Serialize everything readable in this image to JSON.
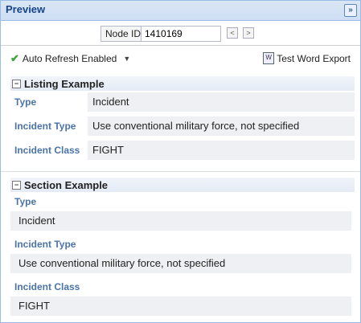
{
  "header": {
    "title": "Preview",
    "collapse_glyph": "»"
  },
  "node": {
    "label": "Node ID",
    "value": "1410169",
    "prev_glyph": "<",
    "next_glyph": ">"
  },
  "toolbar": {
    "check_glyph": "✔",
    "auto_refresh_label": "Auto Refresh Enabled",
    "caret_glyph": "▼",
    "export_label": "Test Word Export",
    "export_icon_glyph": "W"
  },
  "listing": {
    "toggle_glyph": "−",
    "title": "Listing Example",
    "rows": [
      {
        "label": "Type",
        "value": "Incident"
      },
      {
        "label": "Incident Type",
        "value": "Use conventional military force, not specified"
      },
      {
        "label": "Incident Class",
        "value": "FIGHT"
      }
    ]
  },
  "section": {
    "toggle_glyph": "−",
    "title": "Section Example",
    "rows": [
      {
        "label": "Type",
        "value": "Incident"
      },
      {
        "label": "Incident Type",
        "value": "Use conventional military force, not specified"
      },
      {
        "label": "Incident Class",
        "value": "FIGHT"
      }
    ]
  }
}
